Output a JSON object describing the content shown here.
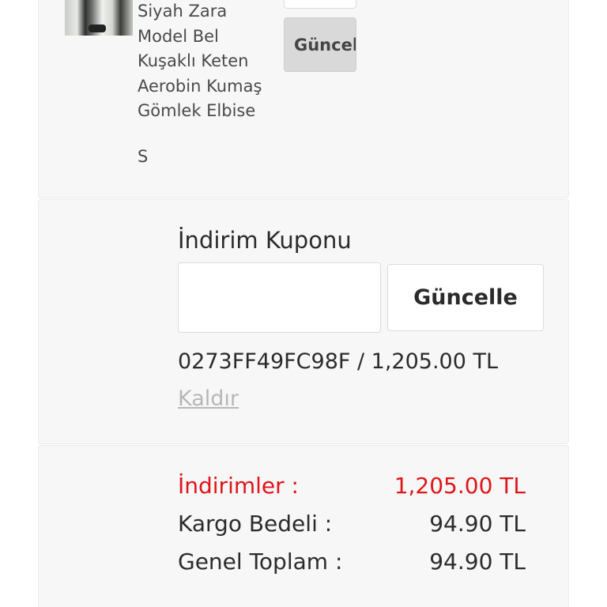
{
  "product": {
    "name_lines": [
      "Siyah Zara",
      "Model Bel",
      "Kuşaklı Keten",
      "Aerobin Kumaş",
      "Gömlek Elbise"
    ],
    "size": "S",
    "update_label": "Güncelle"
  },
  "coupon": {
    "title": "İndirim Kuponu",
    "input_value": "",
    "update_label": "Güncelle",
    "applied_text": "0273FF49FC98F / 1,205.00 TL",
    "remove_label": "Kaldır"
  },
  "totals": {
    "discount_label": "İndirimler :",
    "discount_value": "1,205.00 TL",
    "shipping_label": "Kargo Bedeli :",
    "shipping_value": "94.90 TL",
    "total_label": "Genel Toplam :",
    "total_value": "94.90 TL"
  },
  "colors": {
    "discount": "#e0141a",
    "card_bg": "#f7f7f7",
    "link_muted": "#b7b7b7"
  }
}
